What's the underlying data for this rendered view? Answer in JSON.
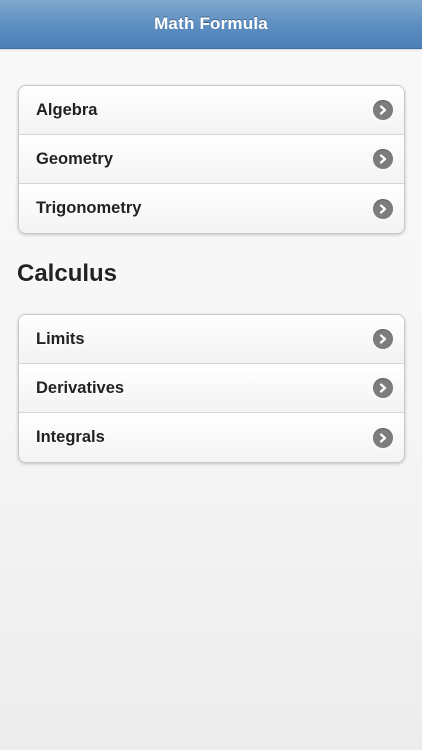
{
  "header": {
    "title": "Math Formula"
  },
  "group1": {
    "items": [
      {
        "label": "Algebra",
        "icon": "chevron-right-icon"
      },
      {
        "label": "Geometry",
        "icon": "chevron-right-icon"
      },
      {
        "label": "Trigonometry",
        "icon": "chevron-right-icon"
      }
    ]
  },
  "calculus": {
    "heading": "Calculus",
    "items": [
      {
        "label": "Limits",
        "icon": "chevron-right-icon"
      },
      {
        "label": "Derivatives",
        "icon": "chevron-right-icon"
      },
      {
        "label": "Integrals",
        "icon": "chevron-right-icon"
      }
    ]
  },
  "colors": {
    "header_top": "#81a8ce",
    "header_bottom": "#4a7fb7",
    "chevron": "#7d7d7d"
  }
}
